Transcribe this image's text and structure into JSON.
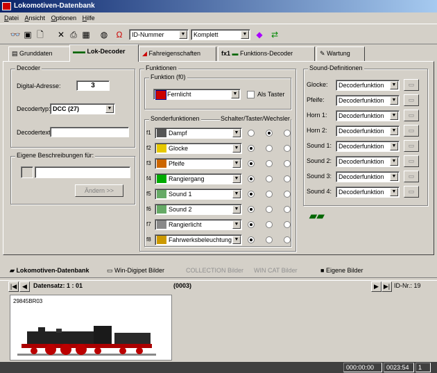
{
  "window": {
    "title": "Lokomotiven-Datenbank"
  },
  "menu": [
    "Datei",
    "Ansicht",
    "Optionen",
    "Hilfe"
  ],
  "toolbar": {
    "id_select": "ID-Nummer",
    "mode_select": "Komplett"
  },
  "tabs": [
    {
      "label": "Grunddaten"
    },
    {
      "label": "Lok-Decoder"
    },
    {
      "label": "Fahreigenschaften"
    },
    {
      "label": "Funktions-Decoder"
    },
    {
      "label": "Wartung"
    }
  ],
  "decoder": {
    "group_label": "Decoder",
    "address_label": "Digital-Adresse:",
    "address_value": "3",
    "type_label": "Decodertyp:",
    "type_value": "DCC (27)",
    "text_label": "Decodertext:",
    "text_value": "",
    "desc_group_label": "Eigene Beschreibungen für:",
    "andern_label": "Ändern >>"
  },
  "funktionen": {
    "group_label": "Funktionen",
    "f0_group_label": "Funktion (f0)",
    "f0_value": "Fernlicht",
    "als_taster_label": "Als Taster",
    "sonder_label": "Sonderfunktionen",
    "schalter_label": "Schalter/Taster/Wechsler",
    "items": [
      {
        "num": "f1",
        "label": "Dampf",
        "sel": 1
      },
      {
        "num": "f2",
        "label": "Glocke",
        "sel": 0
      },
      {
        "num": "f3",
        "label": "Pfeife",
        "sel": 0
      },
      {
        "num": "f4",
        "label": "Rangiergang",
        "sel": 0
      },
      {
        "num": "f5",
        "label": "Sound 1",
        "sel": 0
      },
      {
        "num": "f6",
        "label": "Sound 2",
        "sel": 0
      },
      {
        "num": "f7",
        "label": "Rangierlicht",
        "sel": 0
      },
      {
        "num": "f8",
        "label": "Fahrwerksbeleuchtung",
        "sel": 0
      }
    ]
  },
  "sound": {
    "group_label": "Sound-Definitionen",
    "items": [
      {
        "label": "Glocke:",
        "value": "Decoderfunktion"
      },
      {
        "label": "Pfeife:",
        "value": "Decoderfunktion"
      },
      {
        "label": "Horn 1:",
        "value": "Decoderfunktion"
      },
      {
        "label": "Horn 2:",
        "value": "Decoderfunktion"
      },
      {
        "label": "Sound 1:",
        "value": "Decoderfunktion"
      },
      {
        "label": "Sound 2:",
        "value": "Decoderfunktion"
      },
      {
        "label": "Sound 3:",
        "value": "Decoderfunktion"
      },
      {
        "label": "Sound 4:",
        "value": "Decoderfunktion"
      }
    ]
  },
  "bottom_tabs": [
    {
      "label": "Lokomotiven-Datenbank"
    },
    {
      "label": "Win-Digipet Bilder"
    },
    {
      "label": "COLLECTION Bilder"
    },
    {
      "label": "WIN CAT Bilder"
    },
    {
      "label": "Eigene Bilder"
    }
  ],
  "nav": {
    "record_label": "Datensatz: 1 : 01",
    "record_id": "(0003)",
    "id_label": "ID-Nr.: 19"
  },
  "thumb": {
    "caption": "29845BR03"
  },
  "status": {
    "time": "000:00:00",
    "clock": "0023:54",
    "count": "1"
  },
  "colors": {
    "title_start": "#0a246a",
    "title_end": "#a6caf0",
    "face": "#d4d0c8"
  }
}
